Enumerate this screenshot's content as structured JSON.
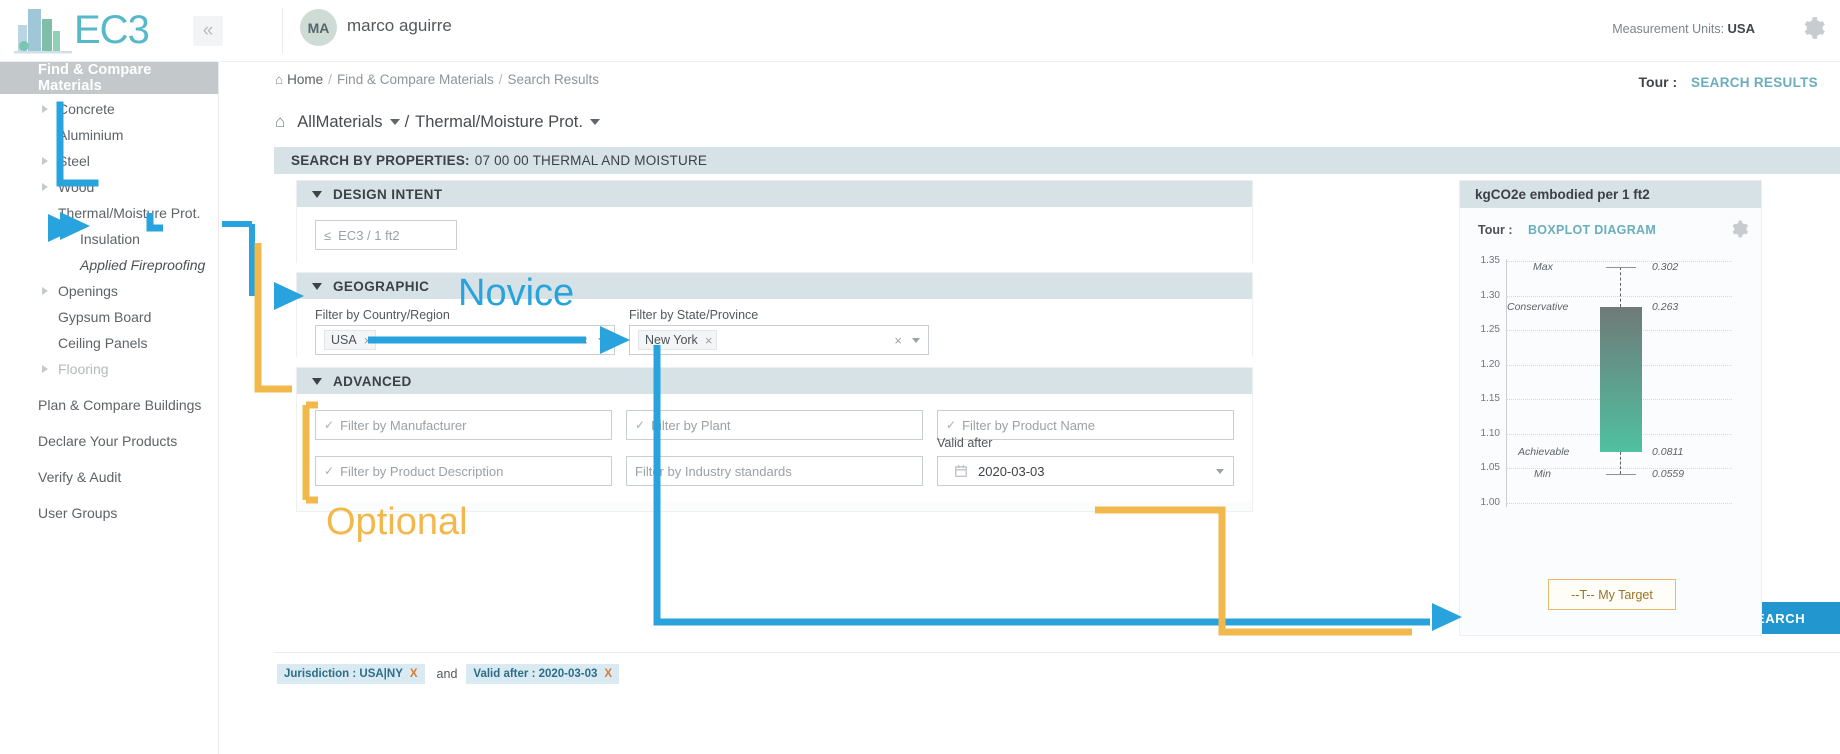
{
  "topbar": {
    "logo_text": "EC3",
    "logo_icon": "building-logo-icon",
    "collapse_icon": "«",
    "avatar_initials": "MA",
    "user_name": "marco aguirre",
    "measurement_units_label": "Measurement Units:",
    "measurement_units_value": "USA",
    "gear_icon": "gear-icon"
  },
  "sidebar": {
    "active_item": "Find & Compare Materials",
    "items": [
      {
        "label": "Concrete",
        "level": 1,
        "caret": true,
        "dim": false,
        "italic": false
      },
      {
        "label": "Aluminium",
        "level": 1,
        "caret": false,
        "dim": false,
        "italic": false
      },
      {
        "label": "Steel",
        "level": 1,
        "caret": true,
        "dim": false,
        "italic": false
      },
      {
        "label": "Wood",
        "level": 1,
        "caret": true,
        "dim": false,
        "italic": false
      },
      {
        "label": "Thermal/Moisture Prot.",
        "level": 1,
        "caret": false,
        "dim": false,
        "italic": false
      },
      {
        "label": "Insulation",
        "level": 2,
        "caret": false,
        "dim": false,
        "italic": false
      },
      {
        "label": "Applied Fireproofing",
        "level": 2,
        "caret": false,
        "dim": false,
        "italic": true
      },
      {
        "label": "Openings",
        "level": 1,
        "caret": true,
        "dim": false,
        "italic": false
      },
      {
        "label": "Gypsum Board",
        "level": 1,
        "caret": false,
        "dim": false,
        "italic": false
      },
      {
        "label": "Ceiling Panels",
        "level": 1,
        "caret": false,
        "dim": false,
        "italic": false
      },
      {
        "label": "Flooring",
        "level": 1,
        "caret": true,
        "dim": true,
        "italic": false
      }
    ],
    "root_items": [
      {
        "label": "Plan & Compare Buildings"
      },
      {
        "label": "Declare Your Products"
      },
      {
        "label": "Verify & Audit"
      },
      {
        "label": "User Groups"
      }
    ]
  },
  "breadcrumb": {
    "home_icon": "home-icon",
    "home": "Home",
    "level1": "Find & Compare Materials",
    "level2": "Search Results",
    "separator": "/"
  },
  "tour": {
    "label": "Tour :",
    "link": "SEARCH RESULTS"
  },
  "material_path": {
    "home_icon": "home-icon",
    "root": "AllMaterials",
    "separator": "/",
    "category": "Thermal/Moisture Prot."
  },
  "properties_bar": {
    "prefix": "SEARCH BY PROPERTIES:",
    "value": "07 00 00 THERMAL AND MOISTURE"
  },
  "design_intent": {
    "title": "DESIGN INTENT",
    "ec3_placeholder": "EC3 / 1 ft2",
    "ec3_prefix": "≤",
    "ec3_value": ""
  },
  "geographic": {
    "title": "GEOGRAPHIC",
    "country_label": "Filter by Country/Region",
    "country_chip": "USA",
    "state_label": "Filter by State/Province",
    "state_chip": "New York",
    "chip_remove_icon": "×",
    "clear_icon": "×"
  },
  "advanced": {
    "title": "ADVANCED",
    "check_icon": "✓",
    "fields": [
      {
        "placeholder": "Filter by Manufacturer",
        "value": "",
        "check": true
      },
      {
        "placeholder": "Filter by Plant",
        "value": "",
        "check": true
      },
      {
        "placeholder": "Filter by Product Name",
        "value": "",
        "check": true
      },
      {
        "placeholder": "Filter by Product Description",
        "value": "",
        "check": true
      },
      {
        "placeholder": "Filter by Industry standards",
        "value": "",
        "check": false
      }
    ],
    "valid_after_label": "Valid after",
    "valid_after_value": "2020-03-03",
    "calendar_icon": "calendar-icon"
  },
  "chart_panel": {
    "title": "kgCO2e embodied per 1 ft2",
    "tour_label": "Tour :",
    "tour_link": "BOXPLOT DIAGRAM",
    "gear_icon": "gear-icon",
    "target_button": "--T-- My Target"
  },
  "chart_data": {
    "type": "boxplot",
    "title": "kgCO2e embodied per 1 ft2",
    "xlabel": "",
    "ylabel": "",
    "ylim": [
      1.0,
      1.35
    ],
    "yticks": [
      "1.35",
      "1.30",
      "1.25",
      "1.20",
      "1.15",
      "1.10",
      "1.05",
      "1.00"
    ],
    "grid": true,
    "box": {
      "max": 0.302,
      "conservative": 0.263,
      "achievable": 0.0811,
      "min": 0.0559
    },
    "annotations": [
      {
        "label": "Max",
        "value": "0.302"
      },
      {
        "label": "Conservative",
        "value": "0.263"
      },
      {
        "label": "Achievable",
        "value": "0.0811"
      },
      {
        "label": "Min",
        "value": "0.0559"
      }
    ],
    "colors": {
      "box_top": "#6f7a78",
      "box_bottom": "#4fc0a0"
    }
  },
  "footer": {
    "tag1": "Jurisdiction : USA|NY",
    "tag1_x": "X",
    "and": "and",
    "tag2": "Valid after : 2020-03-03",
    "tag2_x": "X",
    "search_label": "SEARCH",
    "search_icon": "search-icon"
  },
  "annotations": {
    "novice": "Novice",
    "optional": "Optional",
    "blue": "#29a3dd",
    "orange": "#f2b84b"
  }
}
